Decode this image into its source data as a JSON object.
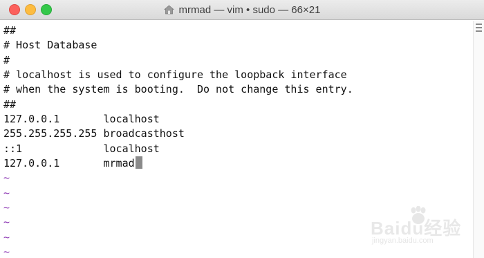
{
  "window": {
    "title": "mrmad — vim • sudo — 66×21",
    "title_icon": "home-folder-icon"
  },
  "terminal": {
    "lines": [
      "##",
      "# Host Database",
      "#",
      "# localhost is used to configure the loopback interface",
      "# when the system is booting.  Do not change this entry.",
      "##",
      "127.0.0.1       localhost",
      "255.255.255.255 broadcasthost",
      "::1             localhost",
      "127.0.0.1       mrmad"
    ],
    "empty_line_marker": "~",
    "empty_line_count": 6
  },
  "colors": {
    "text": "#111111",
    "tilde": "#8e3ab5",
    "cursor": "#8a8a8a",
    "close": "#fc605c",
    "minimize": "#fdbc40",
    "maximize": "#34c84a"
  },
  "watermark": {
    "main": "Baidu经验",
    "sub": "jingyan.baidu.com"
  }
}
